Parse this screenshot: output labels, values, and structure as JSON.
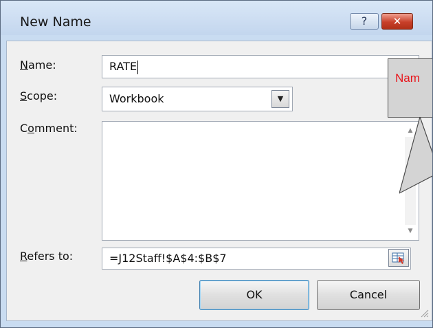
{
  "dialog": {
    "title": "New Name",
    "help_button": "?",
    "close_button": "✕"
  },
  "form": {
    "name_label_underlined": "N",
    "name_label_rest": "ame:",
    "name_value": "RATE",
    "scope_label_underlined": "S",
    "scope_label_rest": "cope:",
    "scope_value": "Workbook",
    "comment_label_pre": "C",
    "comment_label_underlined": "o",
    "comment_label_rest": "mment:",
    "comment_value": "",
    "refers_label_underlined": "R",
    "refers_label_rest": "efers to:",
    "refers_value": "=J12Staff!$A$4:$B$7"
  },
  "buttons": {
    "ok": "OK",
    "cancel": "Cancel"
  },
  "callout": {
    "text": "Nam"
  },
  "colors": {
    "callout_text": "#e8141a",
    "close_button": "#c8402a"
  }
}
